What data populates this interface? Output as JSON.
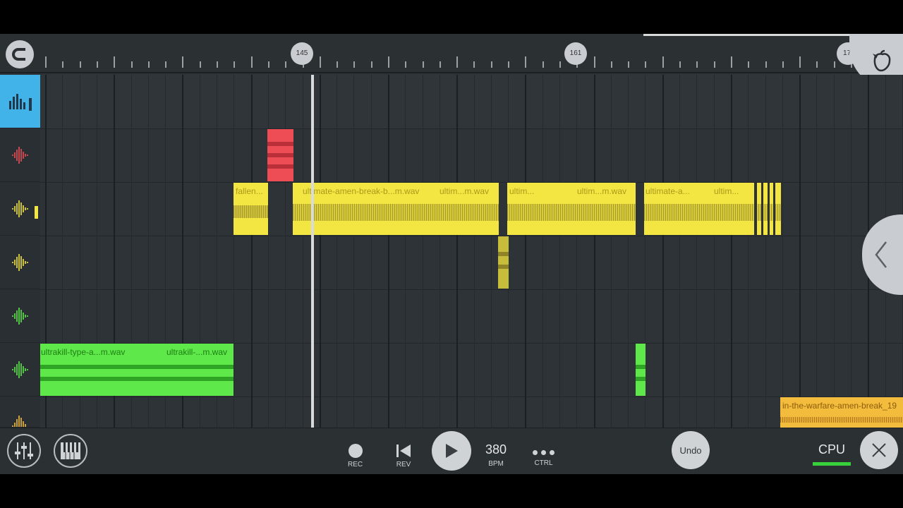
{
  "ruler": {
    "markers": [
      "145",
      "161",
      "17."
    ]
  },
  "clips": {
    "fallen": "fallen...",
    "amen_main": "ultimate-amen-break-b...m.wav",
    "amen_short_1": "ultim...m.wav",
    "amen_short_2": "ultim...",
    "amen_short_3": "ultim...m.wav",
    "amen_a": "ultimate-a...",
    "amen_short_4": "ultim...",
    "ultrakill_1": "ultrakill-type-a...m.wav",
    "ultrakill_2": "ultrakill-...m.wav",
    "warfare": "in-the-warfare-amen-break_19"
  },
  "toolbar": {
    "rec": "REC",
    "rev": "REV",
    "bpm_value": "380",
    "bpm": "BPM",
    "ctrl": "CTRL",
    "undo": "Undo",
    "cpu": "CPU"
  },
  "colors": {
    "accent": "#42b3e8",
    "red": "#ef4d56",
    "yellow": "#f4e642",
    "green": "#5ee84a",
    "orange": "#f4bc3d"
  },
  "icons": [
    "magnet-icon",
    "fl-logo-icon",
    "playlist-icon",
    "waveform-icon",
    "chevron-left-icon",
    "mixer-icon",
    "piano-icon",
    "record-icon",
    "rewind-icon",
    "play-icon",
    "more-icon",
    "close-icon"
  ]
}
